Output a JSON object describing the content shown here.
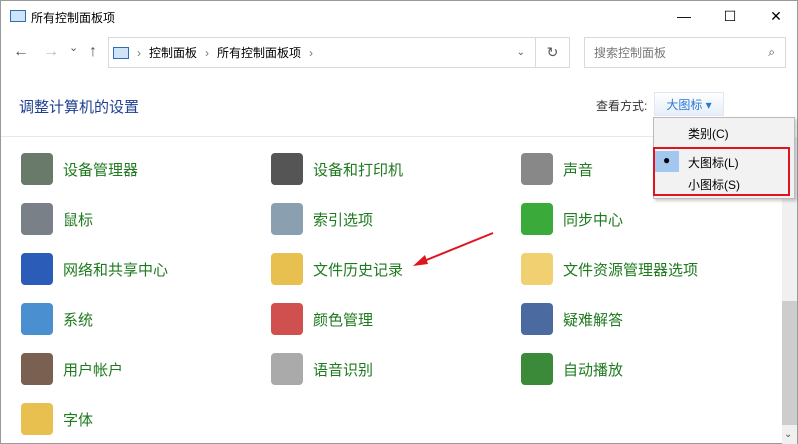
{
  "window": {
    "title": "所有控制面板项",
    "minimize": "—",
    "maximize": "☐",
    "close": "✕"
  },
  "nav": {
    "back": "←",
    "forward": "→",
    "recent": "⌄",
    "up": "↑"
  },
  "breadcrumb": [
    "控制面板",
    "所有控制面板项"
  ],
  "refresh": "↻",
  "search": {
    "placeholder": "搜索控制面板",
    "icon": "⌕"
  },
  "heading": "调整计算机的设置",
  "view": {
    "label": "查看方式:",
    "value": "大图标 ▾"
  },
  "menu": {
    "items": [
      "类别(C)",
      "大图标(L)",
      "小图标(S)"
    ],
    "selected": 1
  },
  "items": [
    {
      "label": "设备管理器",
      "color": "#6a7a6a"
    },
    {
      "label": "设备和打印机",
      "color": "#555"
    },
    {
      "label": "声音",
      "color": "#888"
    },
    {
      "label": "鼠标",
      "color": "#7a8088"
    },
    {
      "label": "索引选项",
      "color": "#8aa0b0"
    },
    {
      "label": "同步中心",
      "color": "#3aaa3a"
    },
    {
      "label": "网络和共享中心",
      "color": "#2a5cb8"
    },
    {
      "label": "文件历史记录",
      "color": "#e8c050"
    },
    {
      "label": "文件资源管理器选项",
      "color": "#f0d070"
    },
    {
      "label": "系统",
      "color": "#4a90d0"
    },
    {
      "label": "颜色管理",
      "color": "#d05050"
    },
    {
      "label": "疑难解答",
      "color": "#4a6aa0"
    },
    {
      "label": "用户帐户",
      "color": "#7a6050"
    },
    {
      "label": "语音识别",
      "color": "#aaa"
    },
    {
      "label": "自动播放",
      "color": "#3a8a3a"
    },
    {
      "label": "字体",
      "color": "#e8c050"
    }
  ],
  "annotation_color": "#e0141e"
}
